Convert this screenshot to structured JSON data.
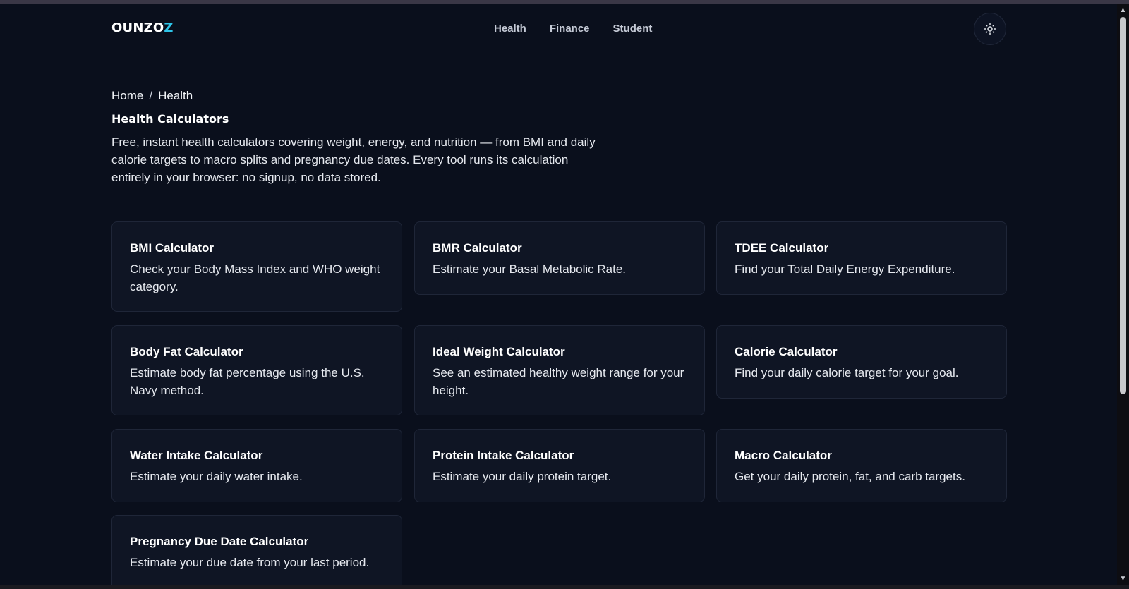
{
  "header": {
    "logo_main": "OUNZO",
    "logo_accent": "Z",
    "nav": [
      {
        "label": "Health"
      },
      {
        "label": "Finance"
      },
      {
        "label": "Student"
      }
    ],
    "theme_icon": "sun-icon"
  },
  "breadcrumb": {
    "home": "Home",
    "separator": "/",
    "current": "Health"
  },
  "page": {
    "title": "Health Calculators",
    "intro": "Free, instant health calculators covering weight, energy, and nutrition — from BMI and daily calorie targets to macro splits and pregnancy due dates. Every tool runs its calculation entirely in your browser: no signup, no data stored."
  },
  "cards": [
    {
      "title": "BMI Calculator",
      "desc": "Check your Body Mass Index and WHO weight category."
    },
    {
      "title": "BMR Calculator",
      "desc": "Estimate your Basal Metabolic Rate."
    },
    {
      "title": "TDEE Calculator",
      "desc": "Find your Total Daily Energy Expenditure."
    },
    {
      "title": "Body Fat Calculator",
      "desc": "Estimate body fat percentage using the U.S. Navy method."
    },
    {
      "title": "Ideal Weight Calculator",
      "desc": "See an estimated healthy weight range for your height."
    },
    {
      "title": "Calorie Calculator",
      "desc": "Find your daily calorie target for your goal."
    },
    {
      "title": "Water Intake Calculator",
      "desc": "Estimate your daily water intake."
    },
    {
      "title": "Protein Intake Calculator",
      "desc": "Estimate your daily protein target."
    },
    {
      "title": "Macro Calculator",
      "desc": "Get your daily protein, fat, and carb targets."
    },
    {
      "title": "Pregnancy Due Date Calculator",
      "desc": "Estimate your due date from your last period."
    }
  ],
  "colors": {
    "background": "#0a0f1c",
    "card": "#0f1524",
    "border": "#1f2638",
    "accent": "#2ec4e8"
  }
}
